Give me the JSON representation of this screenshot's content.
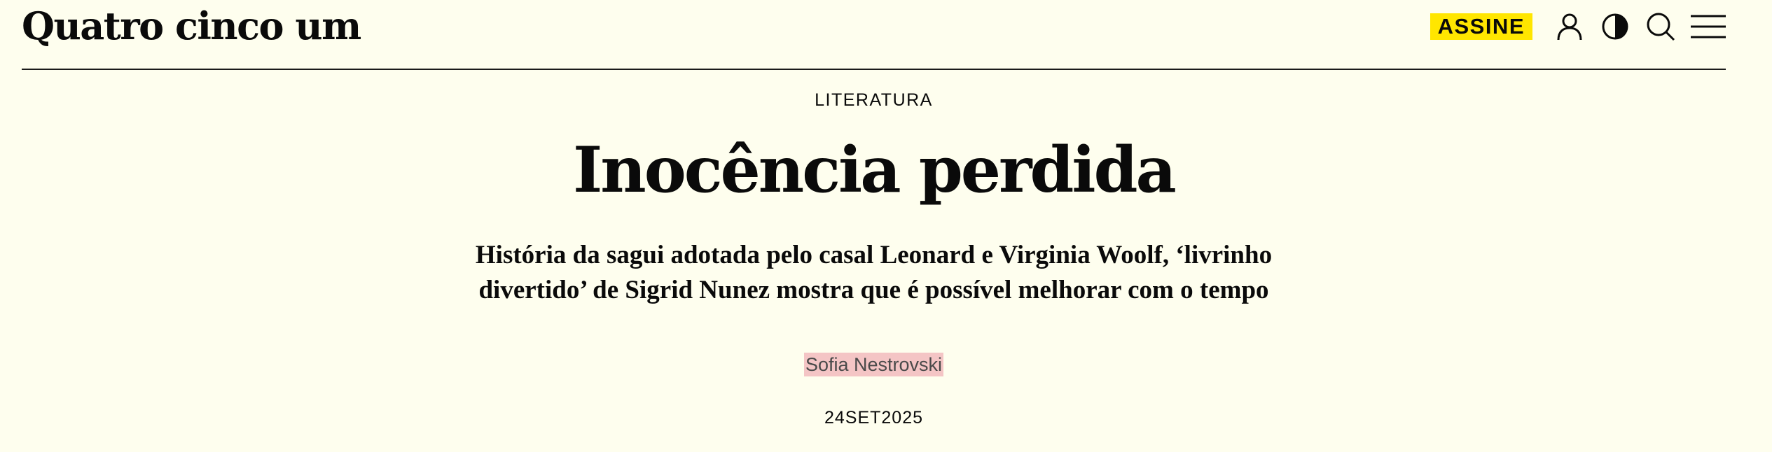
{
  "header": {
    "logo": "Quatro cinco um",
    "subscribe_label": "ASSINE",
    "icons": [
      "user-icon",
      "contrast-icon",
      "search-icon",
      "menu-icon"
    ]
  },
  "article": {
    "section": "LITERATURA",
    "title": "Inocência perdida",
    "subtitle": "História da sagui adotada pelo casal Leonard e Virginia Woolf, ‘livrinho divertido’ de Sigrid Nunez mostra que é possível melhorar com o tempo",
    "author": "Sofia Nestrovski",
    "date": "24SET2025"
  },
  "colors": {
    "background": "#fefeee",
    "subscribe_bg": "#ffe600",
    "author_highlight": "#f4c5c5",
    "text": "#0a0a0a"
  }
}
